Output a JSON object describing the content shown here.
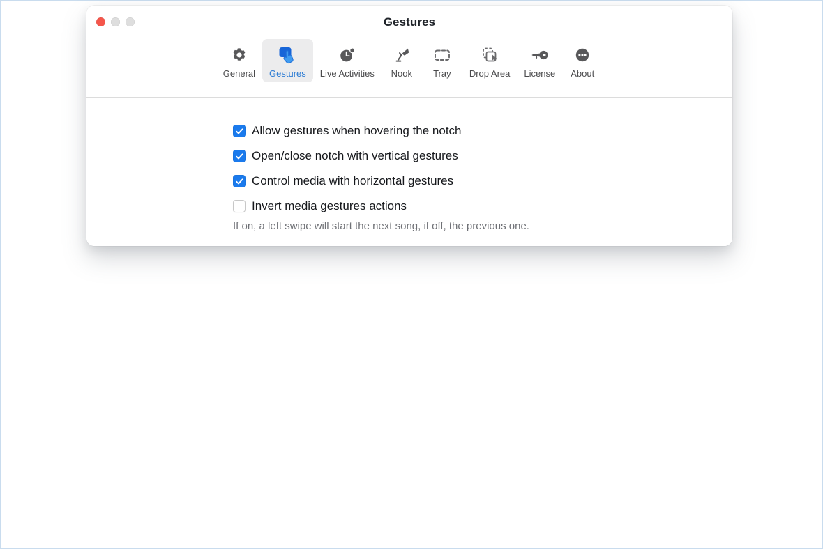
{
  "window": {
    "title": "Gestures",
    "traffic_lights": [
      {
        "name": "close",
        "color": "#f5564b"
      },
      {
        "name": "minimize",
        "color": "#dedede"
      },
      {
        "name": "zoom",
        "color": "#dedede"
      }
    ]
  },
  "toolbar": {
    "selected": "Gestures",
    "selected_color": "#2d7cd4",
    "selected_bg": "#ececed",
    "tabs": [
      {
        "label": "General",
        "icon": "gear-icon"
      },
      {
        "label": "Gestures",
        "icon": "hand-tap-icon"
      },
      {
        "label": "Live Activities",
        "icon": "clock-badge-icon"
      },
      {
        "label": "Nook",
        "icon": "desk-lamp-icon"
      },
      {
        "label": "Tray",
        "icon": "dashed-rectangle-icon"
      },
      {
        "label": "Drop Area",
        "icon": "drop-area-cursor-icon"
      },
      {
        "label": "License",
        "icon": "key-icon"
      },
      {
        "label": "About",
        "icon": "ellipsis-circle-icon"
      }
    ]
  },
  "content": {
    "accent_color": "#1a7aed",
    "options": [
      {
        "label": "Allow gestures when hovering the notch",
        "checked": true
      },
      {
        "label": "Open/close notch with vertical gestures",
        "checked": true
      },
      {
        "label": "Control media with horizontal gestures",
        "checked": true
      },
      {
        "label": "Invert media gestures actions",
        "checked": false
      }
    ],
    "helper_text": "If on, a left swipe will start the next song, if off, the previous one."
  }
}
